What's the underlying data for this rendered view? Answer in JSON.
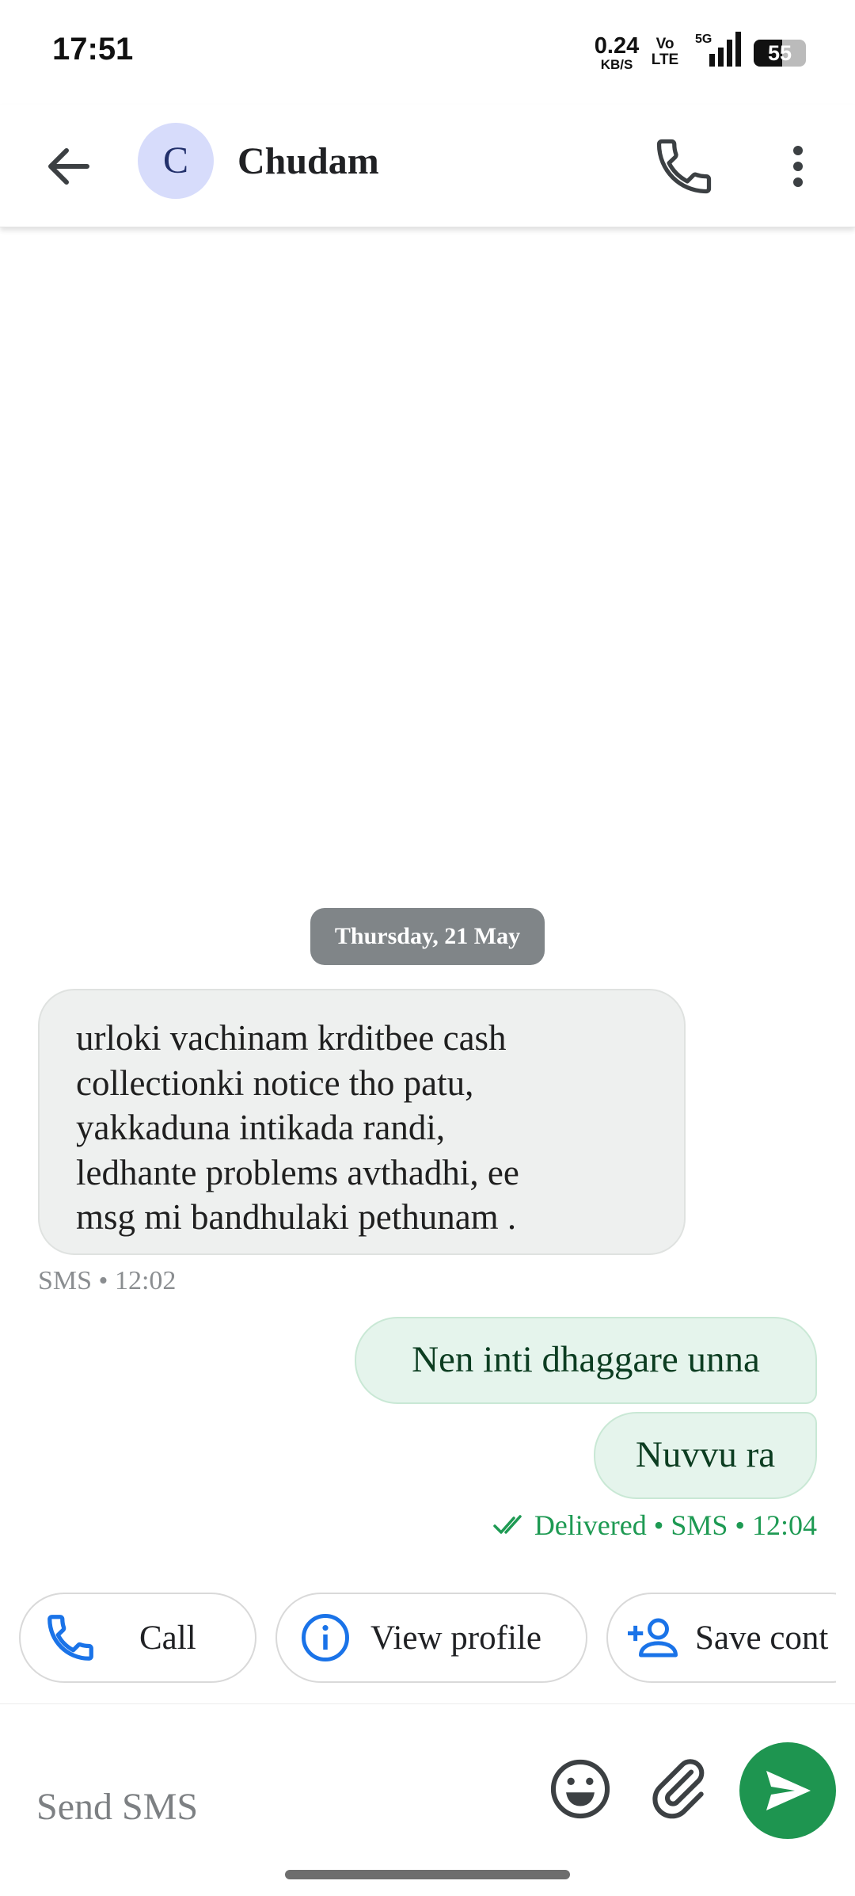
{
  "status_bar": {
    "time": "17:51",
    "net_speed_value": "0.24",
    "net_speed_unit": "KB/S",
    "volte_top": "Vo",
    "volte_bottom": "LTE",
    "signal_label": "5G",
    "battery_percent": "55",
    "icons": [
      "signal-icon",
      "battery-icon"
    ]
  },
  "header": {
    "avatar_letter": "C",
    "contact_name": "Chudam",
    "icons": [
      "back-arrow-icon",
      "phone-icon",
      "more-vert-icon"
    ]
  },
  "conversation": {
    "date_separator": "Thursday, 21 May",
    "incoming": {
      "lines": [
        "urloki vachinam krditbee cash",
        "collectionki notice tho patu,",
        "yakkaduna intikada randi,",
        "ledhante problems avthadhi, ee",
        "msg mi bandhulaki pethunam ."
      ],
      "meta": "SMS • 12:02"
    },
    "outgoing": [
      {
        "text": "Nen inti dhaggare unna"
      },
      {
        "text": "Nuvvu ra"
      }
    ],
    "outgoing_meta": "Delivered • SMS • 12:04",
    "colors": {
      "outgoing_bubble": "#e5f4ec",
      "incoming_bubble": "#eef0ef",
      "accent": "#1e9550"
    }
  },
  "suggestions": [
    {
      "label": "Call",
      "icon": "phone-icon"
    },
    {
      "label": "View profile",
      "icon": "info-icon"
    },
    {
      "label": "Save cont",
      "icon": "add-person-icon"
    }
  ],
  "compose": {
    "placeholder": "Send SMS",
    "icons": [
      "emoji-icon",
      "attach-icon",
      "send-icon"
    ]
  }
}
